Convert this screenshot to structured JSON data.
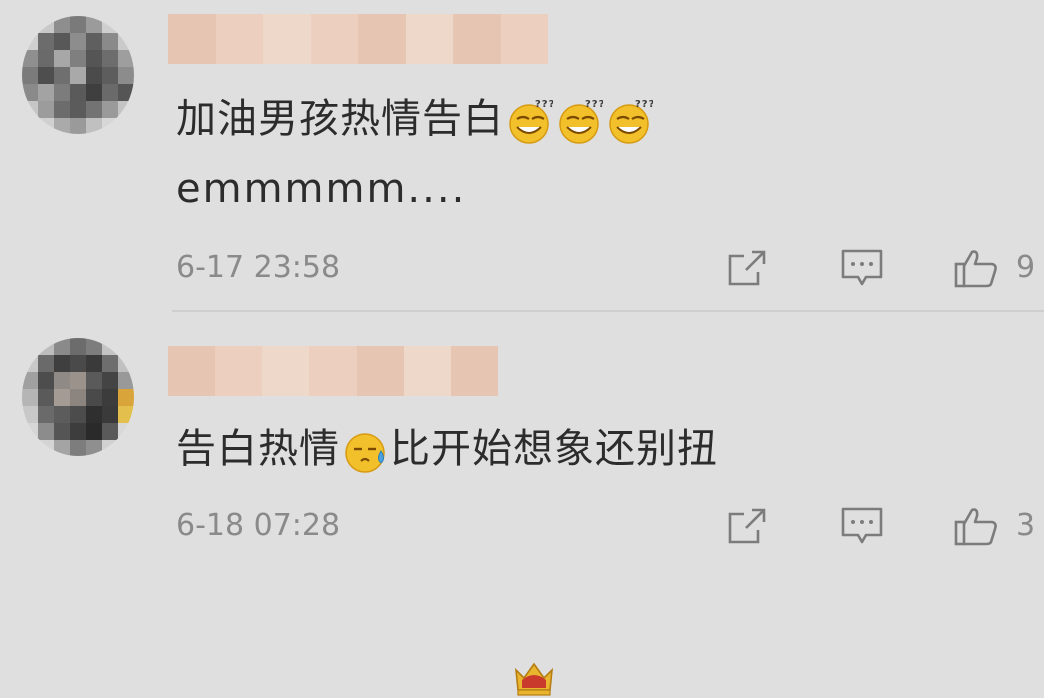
{
  "comments": [
    {
      "text_line1": "加油男孩热情告白",
      "text_line2": "emmmmm....",
      "emoji": "confused-grin-emoji",
      "emoji_count": 3,
      "timestamp": "6-17 23:58",
      "like_count": "9"
    },
    {
      "text_before_emoji": "告白热情",
      "text_after_emoji": "比开始想象还别扭",
      "emoji": "sweat-emoji",
      "timestamp": "6-18 07:28",
      "like_count": "3",
      "badge": "crown-icon"
    }
  ],
  "icons": [
    "share-icon",
    "comment-icon",
    "thumbs-up-icon"
  ],
  "colors": {
    "background": "#dfdfdf",
    "text": "#2c2c2c",
    "meta": "#8a8a8a",
    "blur": "#e8c2ac"
  }
}
